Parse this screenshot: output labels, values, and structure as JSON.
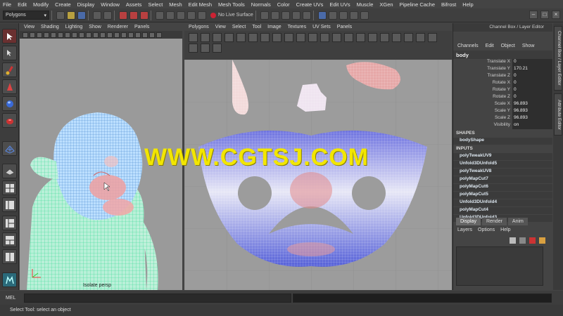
{
  "menubar": {
    "items": [
      "File",
      "Edit",
      "Modify",
      "Create",
      "Display",
      "Window",
      "Assets",
      "Select",
      "Mesh",
      "Edit Mesh",
      "Mesh Tools",
      "Normals",
      "Color",
      "Create UVs",
      "Edit UVs",
      "Muscle",
      "XGen",
      "Pipeline Cache",
      "Bifrost",
      "Help"
    ]
  },
  "shelf": {
    "mode": "Polygons",
    "live_surface": "No Live Surface"
  },
  "persp_panel": {
    "menu": [
      "View",
      "Shading",
      "Lighting",
      "Show",
      "Renderer",
      "Panels"
    ],
    "label": "Isolate  persp"
  },
  "uv_panel": {
    "menu": [
      "Polygons",
      "View",
      "Select",
      "Tool",
      "Image",
      "Textures",
      "UV Sets",
      "Panels"
    ]
  },
  "watermark": "WWW.CGTSJ.COM",
  "channel_box": {
    "title": "Channel Box / Layer Editor",
    "menu": [
      "Channels",
      "Edit",
      "Object",
      "Show"
    ],
    "object": "body",
    "attributes": [
      {
        "k": "Translate X",
        "v": "0"
      },
      {
        "k": "Translate Y",
        "v": "170.21"
      },
      {
        "k": "Translate Z",
        "v": "0"
      },
      {
        "k": "Rotate X",
        "v": "0"
      },
      {
        "k": "Rotate Y",
        "v": "0"
      },
      {
        "k": "Rotate Z",
        "v": "0"
      },
      {
        "k": "Scale X",
        "v": "96.893"
      },
      {
        "k": "Scale Y",
        "v": "96.893"
      },
      {
        "k": "Scale Z",
        "v": "96.893"
      },
      {
        "k": "Visibility",
        "v": "on"
      }
    ],
    "shapes_header": "SHAPES",
    "shapes": [
      "bodyShape"
    ],
    "inputs_header": "INPUTS",
    "inputs": [
      "polyTweakUV9",
      "Unfold3DUnfold5",
      "polyTweakUV8",
      "polyMapCut7",
      "polyMapCut6",
      "polyMapCut5",
      "Unfold3DUnfold4",
      "polyMapCut4",
      "Unfold3DUnfold3"
    ]
  },
  "layer_editor": {
    "tabs": [
      "Display",
      "Render",
      "Anim"
    ],
    "menu": [
      "Layers",
      "Options",
      "Help"
    ]
  },
  "side_tabs": [
    "Channel Box / Layer Editor",
    "Attribute Editor"
  ],
  "command_line": {
    "label": "MEL"
  },
  "help_line": "Select Tool: select an object",
  "colors": {
    "uv_red": "#d05050",
    "uv_blue": "#4a5ad0",
    "wire_green": "#40e0a0",
    "watermark": "#f2e600"
  }
}
